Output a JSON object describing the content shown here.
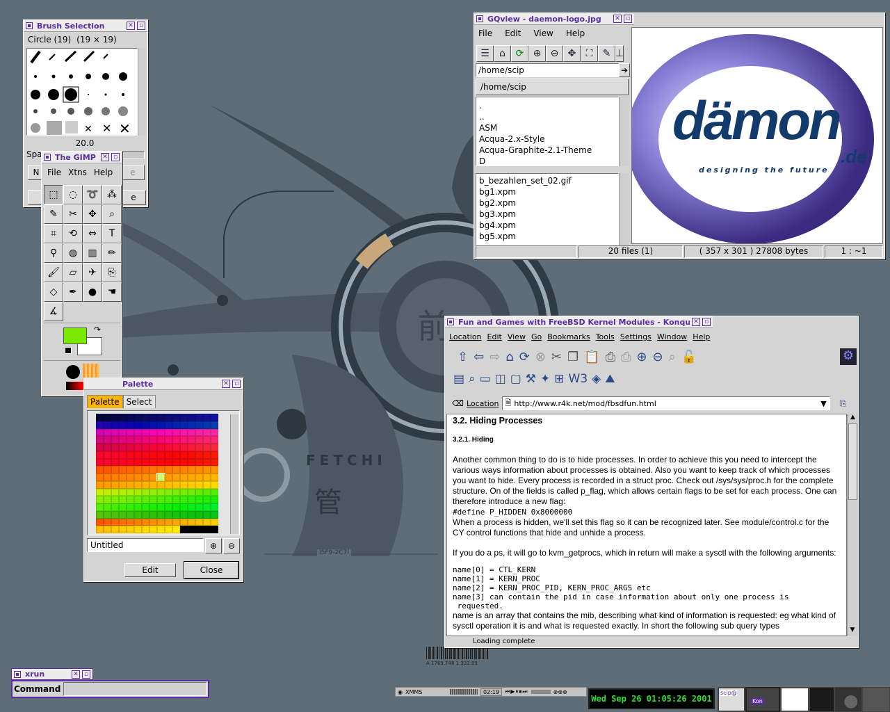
{
  "desktop": {
    "wall_brand": "FETCHI",
    "wall_code": "I5F9-2C7I",
    "wall_kanji_top": "前",
    "wall_kanji_bottom": "管",
    "barcode_text": "A 1769.748 1 333 89"
  },
  "brush": {
    "title": "Brush Selection",
    "brush_name": "Circle (19)",
    "brush_size": "(19 × 19)",
    "spacing_value": "20.0",
    "spacing_label": "Spa"
  },
  "gimp": {
    "title": "The GIMP",
    "menu": [
      "File",
      "Xtns",
      "Help"
    ],
    "tools": [
      "rect-select",
      "ellipse-select",
      "free-select",
      "fuzzy-select",
      "bezier-select",
      "scissors",
      "move",
      "magnify",
      "crop",
      "transform",
      "flip",
      "text",
      "color-picker",
      "bucket-fill",
      "blend",
      "pencil",
      "paintbrush",
      "eraser",
      "airbrush",
      "clone",
      "convolve",
      "ink",
      "dodge-burn",
      "smudge",
      "measure"
    ],
    "fg_color": "#7be800",
    "bg_color": "#ffffff"
  },
  "palette": {
    "title": "Palette",
    "tabs": [
      "Palette",
      "Select"
    ],
    "name_value": "Untitled",
    "edit_label": "Edit",
    "close_label": "Close"
  },
  "gqview": {
    "title": "GQview - daemon-logo.jpg",
    "menu": [
      "File",
      "Edit",
      "View",
      "Help"
    ],
    "path_value": "/home/scip",
    "path_button": "/home/scip",
    "dirs": [
      ".",
      "..",
      "ASM",
      "Acqua-2.x-Style",
      "Acqua-Graphite-2.1-Theme",
      "D"
    ],
    "files": [
      "b_bezahlen_set_02.gif",
      "bg1.xpm",
      "bg2.xpm",
      "bg3.xpm",
      "bg4.xpm",
      "bg5.xpm"
    ],
    "status_count": "20 files (1)",
    "status_size": "( 357 x 301 ) 27808 bytes",
    "status_zoom": "1 : ~1",
    "logo_main": "dämon",
    "logo_tld": ".de",
    "logo_tagline": "designing the future"
  },
  "konq": {
    "title": "Fun and Games with FreeBSD Kernel Modules - Konqueror",
    "menu": [
      "Location",
      "Edit",
      "View",
      "Go",
      "Bookmarks",
      "Tools",
      "Settings",
      "Window",
      "Help"
    ],
    "location_label": "Location",
    "url": "http://www.r4k.net/mod/fbsdfun.html",
    "h2": "3.2. Hiding Processes",
    "h3": "3.2.1. Hiding",
    "p1": "Another common thing to do is to hide processes. In order to achieve this you need to intercept the various ways information about processes is obtained. Also you want to keep track of which processes you want to hide. Every process is recorded in a struct proc. Check out /sys/sys/proc.h for the complete structure. On of the fields is called p_flag, which allows certain flags to be set for each process. One can therefore introduce a new flag:",
    "code1": "#define P_HIDDEN 0x8000000",
    "p2": "When a process is hidden, we'll set this flag so it can be recognized later. See module/control.c for the CY control functions that hide and unhide a process.",
    "p3": "If you do a ps, it will go to kvm_getprocs, which in return will make a sysctl with the following arguments:",
    "code2": [
      "name[0] = CTL_KERN",
      "name[1] = KERN_PROC",
      "name[2] = KERN_PROC_PID, KERN_PROC_ARGS etc",
      "name[3] can contain the pid in case information about only one process is",
      " requested."
    ],
    "p4": "name is an array that contains the mib, describing what kind of information is requested: eg what kind of sysctl operation it is and what is requested exactly. In short the following sub query types",
    "status": "Loading complete"
  },
  "xrun": {
    "title": "xrun",
    "command_label": "Command",
    "command_value": ""
  },
  "taskbar": {
    "xmms_label": "XMMS",
    "xmms_time": "02:19",
    "clock": "Wed Sep 26 01:05:26 2001",
    "pager_label_1": "scip@",
    "pager_label_2": "Kon"
  }
}
